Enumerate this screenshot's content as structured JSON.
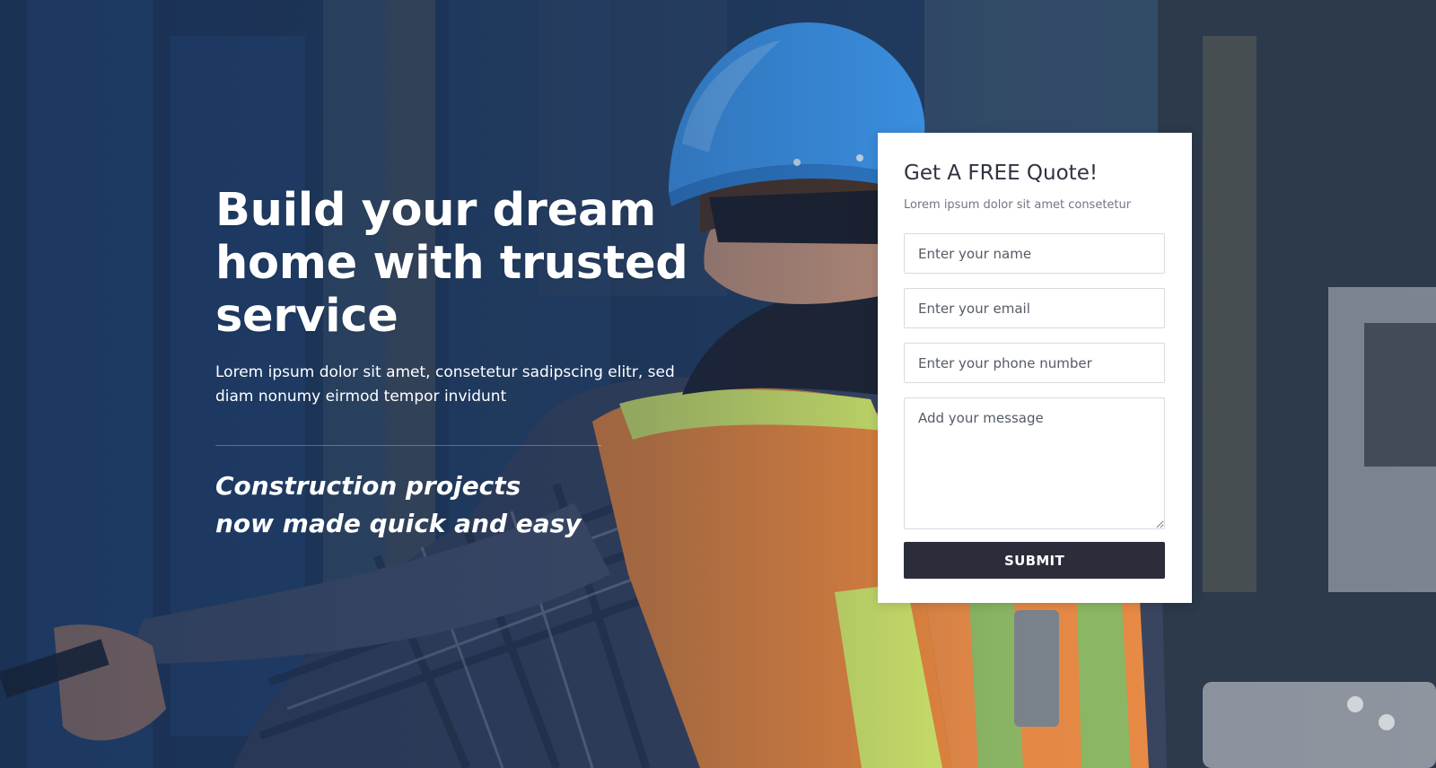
{
  "hero": {
    "title": "Build your dream home with trusted service",
    "subtitle": "Lorem ipsum dolor sit amet, consetetur sadipscing elitr, sed diam nonumy eirmod tempor invidunt",
    "tagline_line1": "Construction projects",
    "tagline_line2": "now made quick and easy"
  },
  "quote_form": {
    "title": "Get A FREE Quote!",
    "subtitle": "Lorem ipsum dolor sit amet consetetur",
    "name_placeholder": "Enter your name",
    "email_placeholder": "Enter your email",
    "phone_placeholder": "Enter your phone number",
    "message_placeholder": "Add your message",
    "submit_label": "SUBMIT"
  },
  "colors": {
    "button_bg": "#2b2d3a",
    "card_bg": "#ffffff",
    "overlay_blue": "#1f3a5c",
    "helmet_blue": "#3f9bf2",
    "vest_orange": "#f08a3c",
    "reflective_yellow": "#d8ee6a"
  },
  "background": {
    "icon": "construction-worker-photo"
  }
}
